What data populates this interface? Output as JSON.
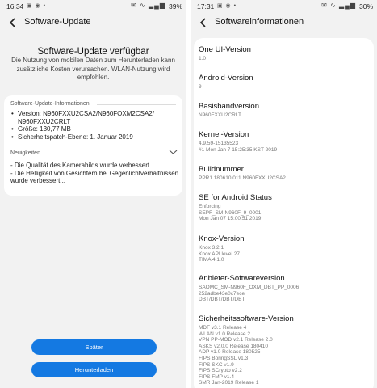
{
  "left": {
    "status": {
      "time": "16:34",
      "battery": "39%"
    },
    "appbar": {
      "title": "Software-Update"
    },
    "headline": "Software-Update verfügbar",
    "intro": "Die Nutzung von mobilen Daten zum Herunterladen kann zusätzliche Kosten verursachen. WLAN-Nutzung wird empfohlen.",
    "info_section": {
      "label": "Software-Update-Informationen",
      "items": [
        "Version: N960FXXU2CSA2/N960FOXM2CSA2/ N960FXXU2CRLT",
        "Größe: 130,77 MB",
        "Sicherheitspatch-Ebene: 1. Januar 2019"
      ]
    },
    "news_section": {
      "label": "Neuigkeiten",
      "line1": " - Die Qualität des Kamerabilds wurde verbessert.",
      "line2": " - Die Helligkeit von Gesichtern bei Gegenlichtverhältnissen wurde verbessert..."
    },
    "buttons": {
      "later": "Später",
      "download": "Herunterladen"
    }
  },
  "right": {
    "status": {
      "time": "17:31",
      "battery": "30%"
    },
    "appbar": {
      "title": "Softwareinformationen"
    },
    "items": [
      {
        "title": "One UI-Version",
        "value": "1.0"
      },
      {
        "title": "Android-Version",
        "value": "9"
      },
      {
        "title": "Basisbandversion",
        "value": "N960FXXU2CRLT"
      },
      {
        "title": "Kernel-Version",
        "value": "4.9.59-15135523\n#1 Mon Jan 7 15:25:35 KST 2019"
      },
      {
        "title": "Buildnummer",
        "value": "PPR1.180610.011.N960FXXU2CSA2"
      },
      {
        "title": "SE for Android Status",
        "value": "Enforcing\nSEPF_SM-N960F_9_0001\nMon Jan 07 15:00:51 2019"
      },
      {
        "title": "Knox-Version",
        "value": "Knox 3.2.1\nKnox API level 27\nTIMA 4.1.0"
      },
      {
        "title": "Anbieter-Softwareversion",
        "value": "SAOMC_SM-N960F_OXM_DBT_PP_0006\n252adbe43e0c7ece\nDBT/DBT/DBT/DBT"
      },
      {
        "title": "Sicherheitssoftware-Version",
        "value": "MDF v3.1 Release 4\nWLAN v1.0 Release 2\nVPN PP-MOD v2.1 Release 2.0\nASKS v2.0.0 Release 180410\nADP v1.0 Release 180525\nFIPS BoringSSL v1.3\nFIPS SKC v1.9\nFIPS SCrypto v2.2\nFIPS FMP v1.4\nSMR Jan-2019 Release 1"
      }
    ]
  }
}
